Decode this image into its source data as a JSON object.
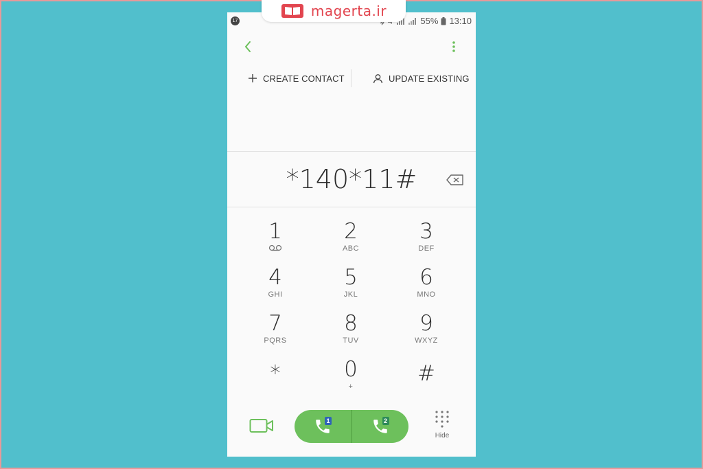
{
  "watermark": {
    "text": "magerta.ir",
    "logo_icon": "open-book-icon",
    "color": "#e2454f"
  },
  "status_bar": {
    "left_badge": "17",
    "battery_percent": "55%",
    "time": "13:10"
  },
  "top_bar": {
    "back_icon": "chevron-left-icon",
    "menu_icon": "more-vertical-icon",
    "accent_color": "#6dc05c"
  },
  "actions": {
    "create_contact_label": "CREATE CONTACT",
    "update_existing_label": "UPDATE EXISTING"
  },
  "dial_display": {
    "number": "*140*11#",
    "backspace_icon": "backspace-icon"
  },
  "keypad": {
    "keys": [
      {
        "digit": "1",
        "sub": ""
      },
      {
        "digit": "2",
        "sub": "ABC"
      },
      {
        "digit": "3",
        "sub": "DEF"
      },
      {
        "digit": "4",
        "sub": "GHI"
      },
      {
        "digit": "5",
        "sub": "JKL"
      },
      {
        "digit": "6",
        "sub": "MNO"
      },
      {
        "digit": "7",
        "sub": "PQRS"
      },
      {
        "digit": "8",
        "sub": "TUV"
      },
      {
        "digit": "9",
        "sub": "WXYZ"
      },
      {
        "digit": "*",
        "sub": ""
      },
      {
        "digit": "0",
        "sub": "+"
      },
      {
        "digit": "#",
        "sub": ""
      }
    ]
  },
  "bottom_bar": {
    "video_icon": "video-camera-icon",
    "sim1_label": "1",
    "sim2_label": "2",
    "sim1_color": "#2f63b8",
    "sim2_color": "#2e8a5a",
    "call_color": "#6dc05c",
    "hide_label": "Hide"
  }
}
